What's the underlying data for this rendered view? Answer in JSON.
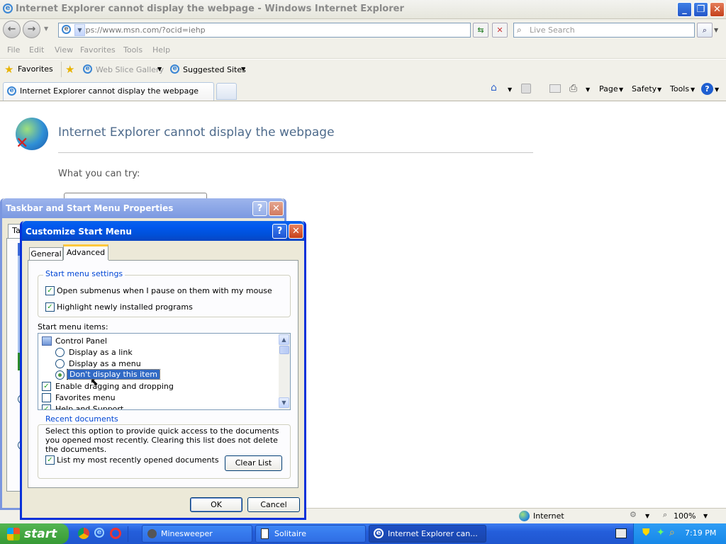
{
  "ie": {
    "title": "Internet Explorer cannot display the webpage - Windows Internet Explorer",
    "url": "https://www.msn.com/?ocid=iehp",
    "search_placeholder": "Live Search",
    "menu": [
      "File",
      "Edit",
      "View",
      "Favorites",
      "Tools",
      "Help"
    ],
    "favorites_label": "Favorites",
    "web_slice": "Web Slice Gallery",
    "suggested": "Suggested Sites",
    "tab_label": "Internet Explorer cannot display the webpage",
    "commands": {
      "page": "Page",
      "safety": "Safety",
      "tools": "Tools"
    },
    "page_heading": "Internet Explorer cannot display the webpage",
    "page_try": "What you can try:",
    "status_zone": "Internet",
    "zoom": "100%"
  },
  "taskbar_props": {
    "title": "Taskbar and Start Menu Properties",
    "tab_stub": "Ta"
  },
  "dialog": {
    "title": "Customize Start Menu",
    "tabs": [
      "General",
      "Advanced"
    ],
    "settings_group": "Start menu settings",
    "settings": [
      {
        "label": "Open submenus when I pause on them with my mouse",
        "checked": true
      },
      {
        "label": "Highlight newly installed programs",
        "checked": true
      }
    ],
    "items_label": "Start menu items:",
    "items": {
      "control_panel": "Control Panel",
      "radio": [
        "Display as a link",
        "Display as a menu",
        "Don't display this item"
      ],
      "selected_radio": 2,
      "drag": "Enable dragging and dropping",
      "favorites": "Favorites menu",
      "help": "Help and Support"
    },
    "recent_group": "Recent documents",
    "recent_text": "Select this option to provide quick access to the documents you opened most recently.  Clearing this list does not delete the documents.",
    "recent_check": "List my most recently opened documents",
    "clear_btn": "Clear List",
    "ok": "OK",
    "cancel": "Cancel"
  },
  "taskbar": {
    "start": "start",
    "tasks": [
      "Minesweeper",
      "Solitaire",
      "Internet Explorer can..."
    ],
    "clock": "7:19 PM"
  }
}
